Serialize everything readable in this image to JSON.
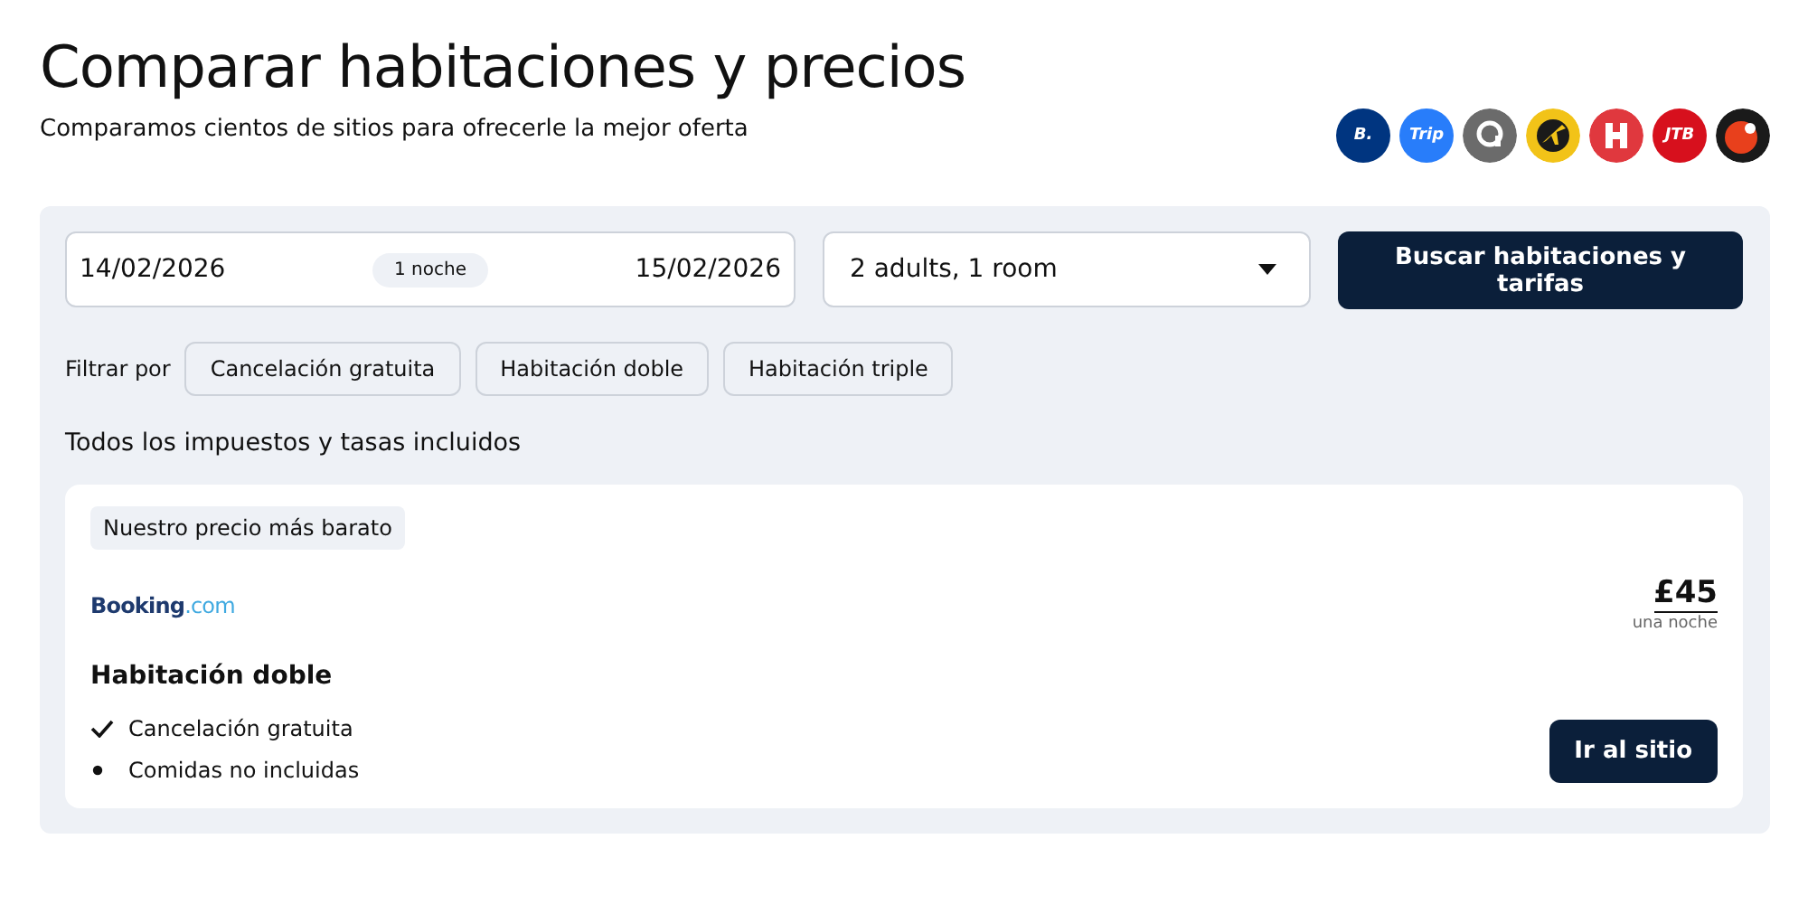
{
  "header": {
    "title": "Comparar habitaciones y precios",
    "subtitle": "Comparamos cientos de sitios para ofrecerle la mejor oferta"
  },
  "providers": [
    {
      "kind": "text",
      "text": "B.",
      "color": "#003580"
    },
    {
      "kind": "text",
      "text": "Trip",
      "color": "#287dfa"
    },
    {
      "kind": "ring",
      "color": "#6b6b6b"
    },
    {
      "kind": "plane",
      "color": "#f2c318"
    },
    {
      "kind": "h",
      "color": "#e0383e"
    },
    {
      "kind": "text",
      "text": "JTB",
      "color": "#d7101d"
    },
    {
      "kind": "dot",
      "color": "#1a1a1a"
    }
  ],
  "search": {
    "checkin": "14/02/2026",
    "nights": "1 noche",
    "checkout": "15/02/2026",
    "guests": "2 adults, 1 room",
    "button": "Buscar habitaciones y tarifas"
  },
  "filters": {
    "label": "Filtrar por",
    "chips": [
      {
        "label": "Cancelación gratuita",
        "selected": false
      },
      {
        "label": "Habitación doble",
        "selected": false
      },
      {
        "label": "Habitación triple",
        "selected": false
      }
    ]
  },
  "tax_note": "Todos los impuestos y tasas incluidos",
  "offer": {
    "badge": "Nuestro precio más barato",
    "site": "Booking",
    "site_suffix": ".com",
    "price": "£45",
    "price_unit": "una noche",
    "room": "Habitación doble",
    "features": [
      {
        "kind": "check",
        "text": "Cancelación gratuita"
      },
      {
        "kind": "bullet",
        "text": "Comidas no incluidas"
      }
    ],
    "button": "Ir al sitio"
  }
}
